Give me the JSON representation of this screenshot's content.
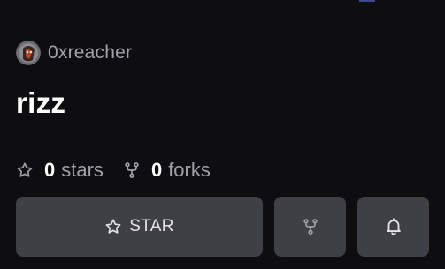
{
  "repo": {
    "owner": "0xreacher",
    "name": "rizz",
    "stars_count": "0",
    "stars_label": "stars",
    "forks_count": "0",
    "forks_label": "forks"
  },
  "actions": {
    "star_label": "STAR"
  },
  "icons": {
    "stars": "star-outline-icon",
    "forks": "git-fork-icon",
    "star_button": "star-outline-icon",
    "fork_button": "git-fork-icon",
    "watch_button": "bell-icon"
  },
  "colors": {
    "background": "#0e0e11",
    "button": "#3f3f46",
    "muted_text": "#a1a1aa",
    "primary_text": "#ffffff"
  }
}
